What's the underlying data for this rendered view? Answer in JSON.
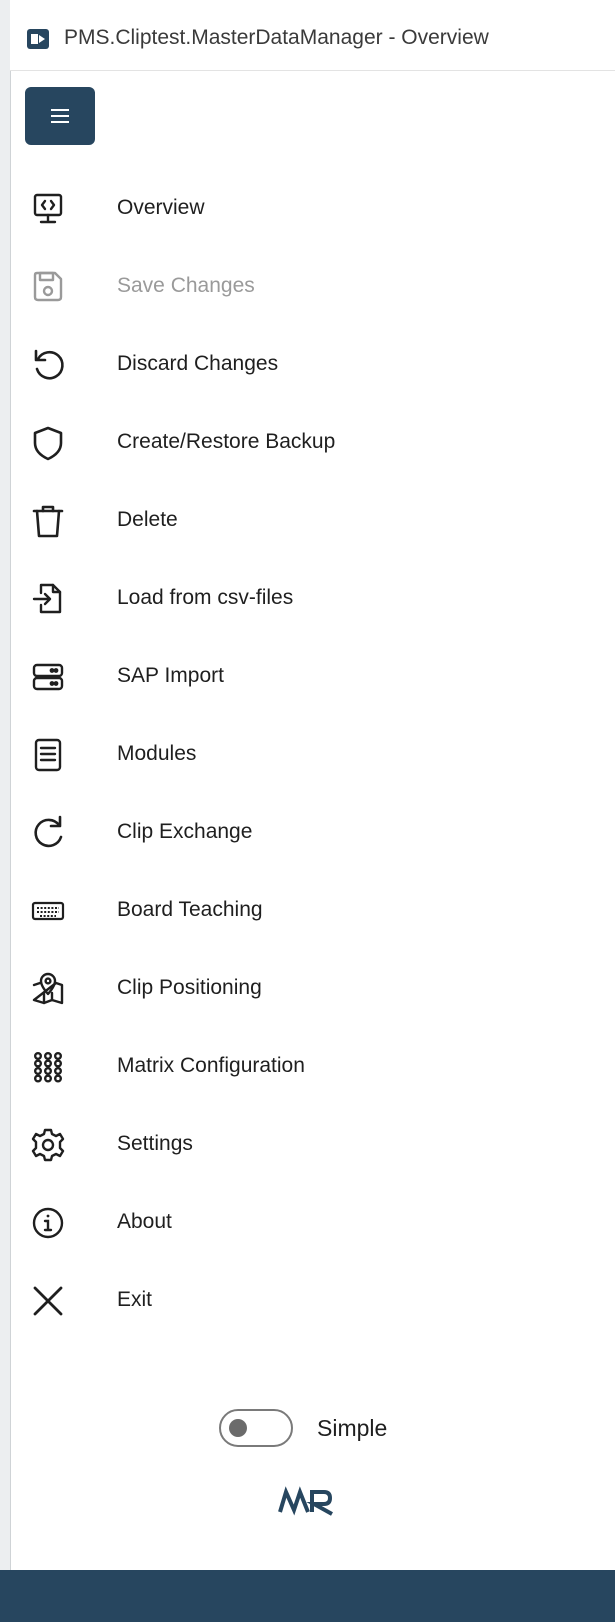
{
  "window": {
    "title": "PMS.Cliptest.MasterDataManager - Overview"
  },
  "menu": {
    "items": [
      {
        "key": "overview",
        "label": "Overview",
        "icon": "monitor-code-icon",
        "enabled": true
      },
      {
        "key": "save",
        "label": "Save Changes",
        "icon": "floppy-disk-icon",
        "enabled": false
      },
      {
        "key": "discard",
        "label": "Discard Changes",
        "icon": "undo-icon",
        "enabled": true
      },
      {
        "key": "backup",
        "label": "Create/Restore Backup",
        "icon": "shield-icon",
        "enabled": true
      },
      {
        "key": "delete",
        "label": "Delete",
        "icon": "trash-icon",
        "enabled": true
      },
      {
        "key": "load-csv",
        "label": "Load from csv-files",
        "icon": "file-import-icon",
        "enabled": true
      },
      {
        "key": "sap-import",
        "label": "SAP Import",
        "icon": "server-icon",
        "enabled": true
      },
      {
        "key": "modules",
        "label": "Modules",
        "icon": "document-list-icon",
        "enabled": true
      },
      {
        "key": "clip-exchange",
        "label": "Clip Exchange",
        "icon": "refresh-icon",
        "enabled": true
      },
      {
        "key": "board-teaching",
        "label": "Board Teaching",
        "icon": "keyboard-icon",
        "enabled": true
      },
      {
        "key": "clip-positioning",
        "label": "Clip Positioning",
        "icon": "map-pin-icon",
        "enabled": true
      },
      {
        "key": "matrix-config",
        "label": "Matrix Configuration",
        "icon": "grid-icon",
        "enabled": true
      },
      {
        "key": "settings",
        "label": "Settings",
        "icon": "gear-icon",
        "enabled": true
      },
      {
        "key": "about",
        "label": "About",
        "icon": "info-icon",
        "enabled": true
      },
      {
        "key": "exit",
        "label": "Exit",
        "icon": "close-icon",
        "enabled": true
      }
    ]
  },
  "mode_toggle": {
    "label": "Simple",
    "checked": false
  },
  "colors": {
    "accent": "#27465f",
    "text": "#1f1f1f",
    "disabled": "#9a9a9a"
  }
}
